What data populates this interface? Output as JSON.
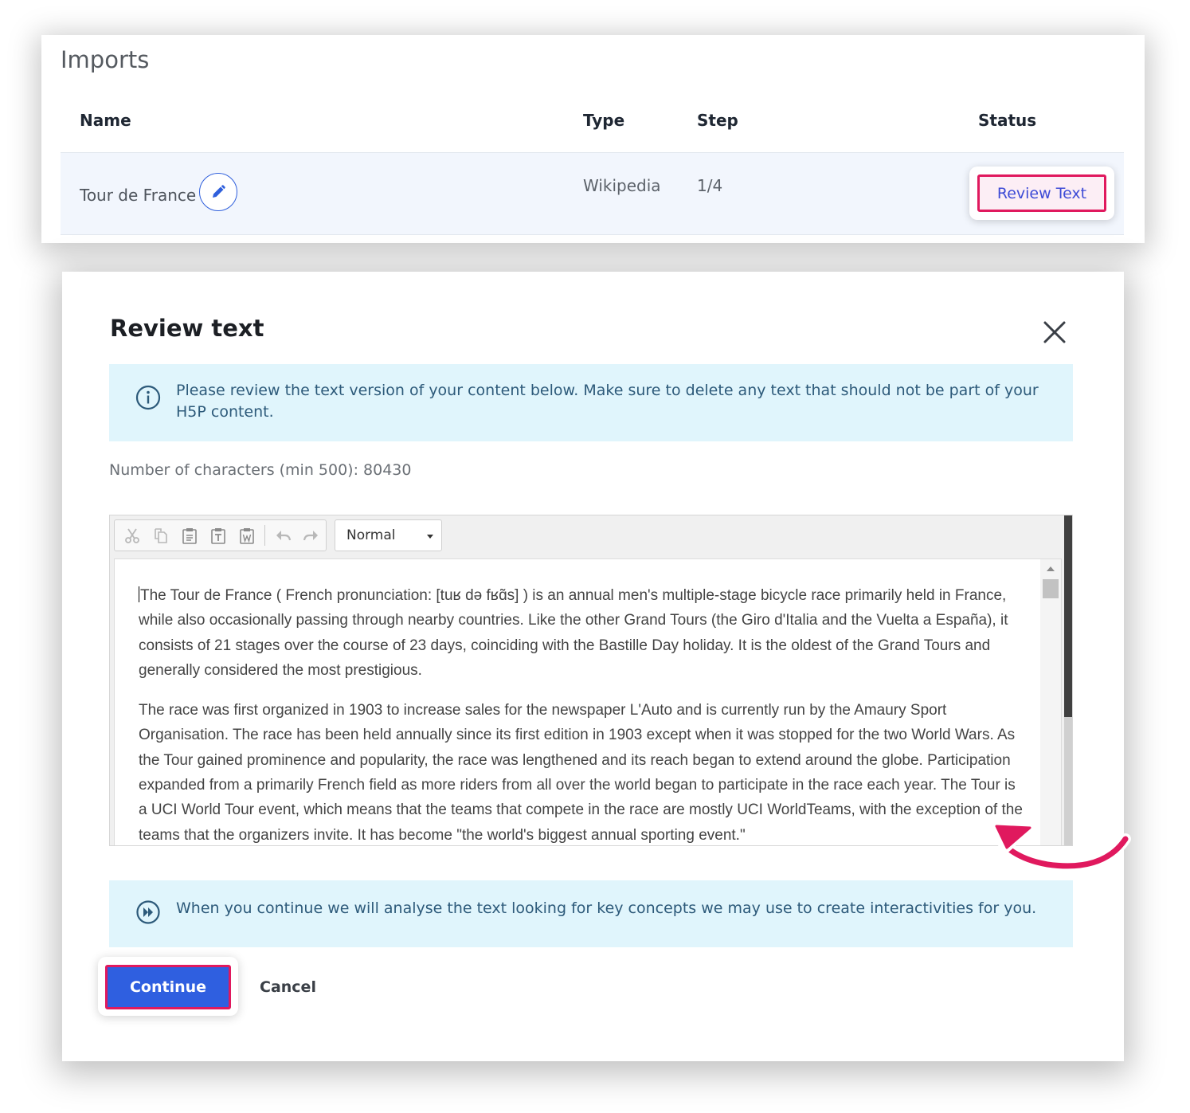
{
  "imports": {
    "title": "Imports",
    "columns": [
      "Name",
      "Type",
      "Step",
      "Status"
    ],
    "rows": [
      {
        "name": "Tour de France",
        "type": "Wikipedia",
        "step": "1/4",
        "status": "Review Text"
      }
    ]
  },
  "modal": {
    "title": "Review text",
    "info": "Please review the text version of your content below. Make sure to delete any text that should not be part of your H5P content.",
    "char_count_label": "Number of characters (min 500):",
    "char_count_value": "80430",
    "editor": {
      "format": "Normal",
      "toolbar_icons": [
        "cut-icon",
        "copy-icon",
        "paste-icon",
        "paste-text-icon",
        "paste-word-icon",
        "undo-icon",
        "redo-icon"
      ],
      "paragraphs": [
        "The Tour de France ( French pronunciation:  [tuʁ də fʁɑ̃s] ) is an annual men's multiple-stage bicycle race primarily held in France, while also occasionally passing through nearby countries. Like the other Grand Tours (the Giro d'Italia and the Vuelta a España), it consists of 21 stages over the course of 23 days, coinciding with the Bastille Day holiday. It is the oldest of the Grand Tours and generally considered the most prestigious.",
        "The race was first organized in 1903 to increase sales for the newspaper L'Auto and is currently run by the Amaury Sport Organisation. The race has been held annually since its first edition in 1903 except when it was stopped for the two World Wars. As the Tour gained prominence and popularity, the race was lengthened and its reach began to extend around the globe. Participation expanded from a primarily French field as more riders from all over the world began to participate in the race each year. The Tour is a UCI World Tour event, which means that the teams that compete in the race are mostly UCI WorldTeams, with the exception of the teams that the organizers invite. It has become \"the world's biggest annual sporting event.\""
      ]
    },
    "continue_info": "When you continue we will analyse the text looking for key concepts we may use to create interactivities for you.",
    "continue_label": "Continue",
    "cancel_label": "Cancel"
  },
  "colors": {
    "accent_highlight": "#e0195e",
    "primary_button": "#2f5fe0",
    "info_background": "#e0f5fc",
    "info_text": "#2d5a7a"
  }
}
